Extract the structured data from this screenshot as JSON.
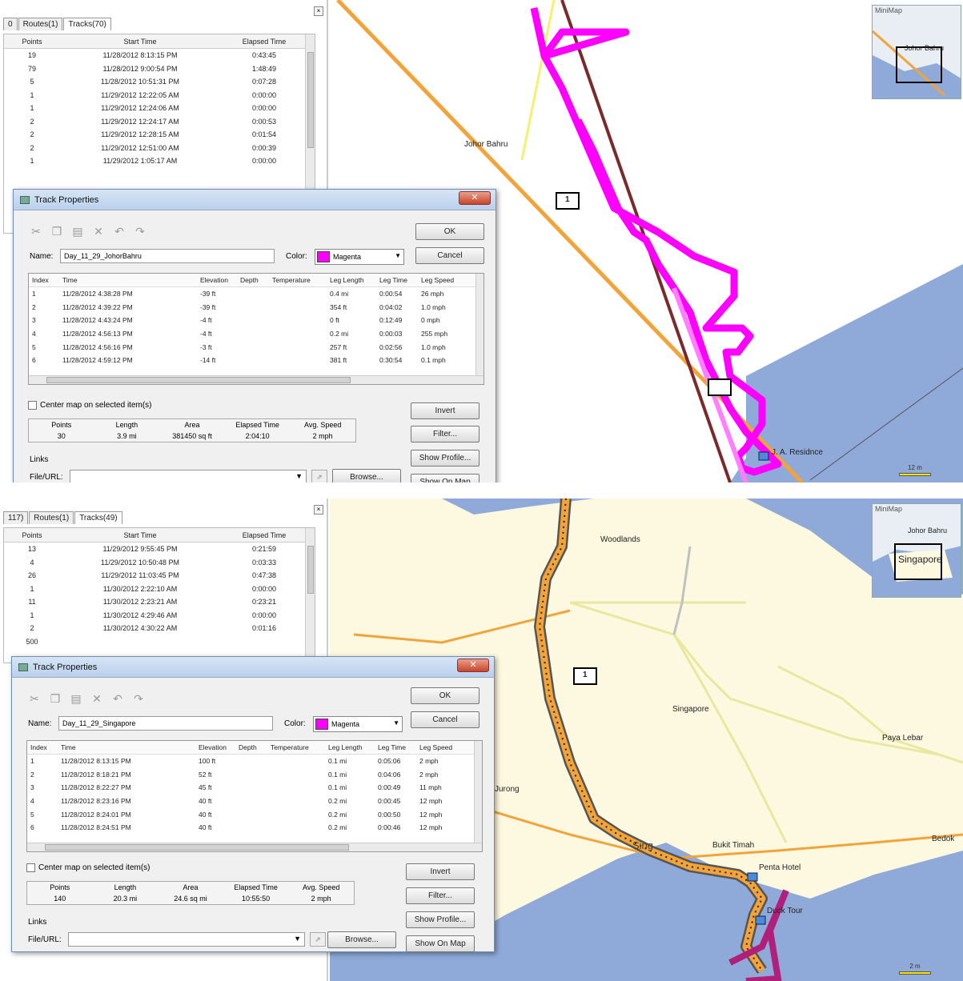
{
  "top": {
    "tabs": [
      "0",
      "Routes(1)",
      "Tracks(70)"
    ],
    "track_list": {
      "headers": [
        "Points",
        "Start Time",
        "Elapsed Time"
      ],
      "rows": [
        [
          "19",
          "11/28/2012 8:13:15 PM",
          "0:43:45"
        ],
        [
          "79",
          "11/28/2012 9:00:54 PM",
          "1:48:49"
        ],
        [
          "5",
          "11/28/2012 10:51:31 PM",
          "0:07:28"
        ],
        [
          "1",
          "11/29/2012 12:22:05 AM",
          "0:00:00"
        ],
        [
          "1",
          "11/29/2012 12:24:06 AM",
          "0:00:00"
        ],
        [
          "2",
          "11/29/2012 12:24:17 AM",
          "0:00:53"
        ],
        [
          "2",
          "11/29/2012 12:28:15 AM",
          "0:01:54"
        ],
        [
          "2",
          "11/29/2012 12:51:00 AM",
          "0:00:39"
        ],
        [
          "1",
          "11/29/2012 1:05:17 AM",
          "0:00:00"
        ]
      ]
    },
    "dialog": {
      "title": "Track Properties",
      "toolbar_icons": [
        "cut-icon",
        "copy-icon",
        "paste-icon",
        "delete-icon",
        "undo-icon",
        "redo-icon"
      ],
      "name_label": "Name:",
      "name_value": "Day_11_29_JohorBahru",
      "color_label": "Color:",
      "color_value": "Magenta",
      "color_swatch": "#ff00ff",
      "buttons": {
        "ok": "OK",
        "cancel": "Cancel",
        "invert": "Invert",
        "filter": "Filter...",
        "show_profile": "Show Profile...",
        "show_on_map": "Show On Map",
        "browse": "Browse..."
      },
      "grid_headers": [
        "Index",
        "Time",
        "Elevation",
        "Depth",
        "Temperature",
        "Leg Length",
        "Leg Time",
        "Leg Speed"
      ],
      "grid_rows": [
        [
          "1",
          "11/28/2012 4:38:28 PM",
          "-39 ft",
          "",
          "",
          "0.4 mi",
          "0:00:54",
          "26 mph"
        ],
        [
          "2",
          "11/28/2012 4:39:22 PM",
          "-39 ft",
          "",
          "",
          "354 ft",
          "0:04:02",
          "1.0 mph"
        ],
        [
          "3",
          "11/28/2012 4:43:24 PM",
          "-4 ft",
          "",
          "",
          "0 ft",
          "0:12:49",
          "0 mph"
        ],
        [
          "4",
          "11/28/2012 4:56:13 PM",
          "-4 ft",
          "",
          "",
          "0.2 mi",
          "0:00:03",
          "255 mph"
        ],
        [
          "5",
          "11/28/2012 4:56:16 PM",
          "-3 ft",
          "",
          "",
          "257 ft",
          "0:02:56",
          "1.0 mph"
        ],
        [
          "6",
          "11/28/2012 4:59:12 PM",
          "-14 ft",
          "",
          "",
          "381 ft",
          "0:30:54",
          "0.1 mph"
        ]
      ],
      "center_map_label": "Center map on selected item(s)",
      "stats_headers": [
        "Points",
        "Length",
        "Area",
        "Elapsed Time",
        "Avg. Speed"
      ],
      "stats_values": [
        "30",
        "3.9 mi",
        "381450 sq ft",
        "2:04:10",
        "2 mph"
      ],
      "links_label": "Links",
      "fileurl_label": "File/URL:"
    },
    "map": {
      "labels": {
        "johor": "Johor Bahru",
        "road_sign": "1",
        "poi": "J. A. Residnce"
      },
      "minimap_title": "MiniMap",
      "minimap_label": "Johor Bahru",
      "scale": "12 m"
    }
  },
  "bottom": {
    "tabs": [
      "117)",
      "Routes(1)",
      "Tracks(49)"
    ],
    "track_list": {
      "headers": [
        "Points",
        "Start Time",
        "Elapsed Time"
      ],
      "rows": [
        [
          "13",
          "11/29/2012 9:55:45 PM",
          "0:21:59"
        ],
        [
          "4",
          "11/29/2012 10:50:48 PM",
          "0:03:33"
        ],
        [
          "26",
          "11/29/2012 11:03:45 PM",
          "0:47:38"
        ],
        [
          "1",
          "11/30/2012 2:22:10 AM",
          "0:00:00"
        ],
        [
          "11",
          "11/30/2012 2:23:21 AM",
          "0:23:21"
        ],
        [
          "1",
          "11/30/2012 4:29:46 AM",
          "0:00:00"
        ],
        [
          "2",
          "11/30/2012 4:30:22 AM",
          "0:01:16"
        ],
        [
          "500",
          "",
          ""
        ]
      ]
    },
    "dialog": {
      "title": "Track Properties",
      "toolbar_icons": [
        "cut-icon",
        "copy-icon",
        "paste-icon",
        "delete-icon",
        "undo-icon",
        "redo-icon"
      ],
      "name_label": "Name:",
      "name_value": "Day_11_29_Singapore",
      "color_label": "Color:",
      "color_value": "Magenta",
      "color_swatch": "#ff00ff",
      "buttons": {
        "ok": "OK",
        "cancel": "Cancel",
        "invert": "Invert",
        "filter": "Filter...",
        "show_profile": "Show Profile...",
        "show_on_map": "Show On Map",
        "browse": "Browse..."
      },
      "grid_headers": [
        "Index",
        "Time",
        "Elevation",
        "Depth",
        "Temperature",
        "Leg Length",
        "Leg Time",
        "Leg Speed"
      ],
      "grid_rows": [
        [
          "1",
          "11/28/2012 8:13:15 PM",
          "100 ft",
          "",
          "",
          "0.1 mi",
          "0:05:06",
          "2 mph"
        ],
        [
          "2",
          "11/28/2012 8:18:21 PM",
          "52 ft",
          "",
          "",
          "0.1 mi",
          "0:04:06",
          "2 mph"
        ],
        [
          "3",
          "11/28/2012 8:22:27 PM",
          "45 ft",
          "",
          "",
          "0.1 mi",
          "0:00:49",
          "11 mph"
        ],
        [
          "4",
          "11/28/2012 8:23:16 PM",
          "40 ft",
          "",
          "",
          "0.2 mi",
          "0:00:45",
          "12 mph"
        ],
        [
          "5",
          "11/28/2012 8:24:01 PM",
          "40 ft",
          "",
          "",
          "0.2 mi",
          "0:00:50",
          "12 mph"
        ],
        [
          "6",
          "11/28/2012 8:24:51 PM",
          "40 ft",
          "",
          "",
          "0.2 mi",
          "0:00:46",
          "12 mph"
        ]
      ],
      "center_map_label": "Center map on selected item(s)",
      "stats_headers": [
        "Points",
        "Length",
        "Area",
        "Elapsed Time",
        "Avg. Speed"
      ],
      "stats_values": [
        "140",
        "20.3 mi",
        "24.6 sq mi",
        "10:55:50",
        "2 mph"
      ],
      "links_label": "Links",
      "fileurl_label": "File/URL:"
    },
    "map": {
      "labels": {
        "woodlands": "Woodlands",
        "singapore": "Singapore",
        "paya_lebar": "Paya Lebar",
        "jurong": "Jurong",
        "bukit_timah": "Bukit Timah",
        "bedok": "Bedok",
        "penta_hotel": "Penta Hotel",
        "duck_tour": "Duck Tour",
        "sing": "Sing",
        "road_sign": "1"
      },
      "minimap_title": "MiniMap",
      "minimap_labels": [
        "Johor Bahru",
        "Singapore"
      ],
      "scale": "2 m"
    }
  },
  "colors": {
    "track": "#ff00ff",
    "route_orange": "#f2a33a",
    "water": "#8faad8",
    "land": "#fdf9e1"
  }
}
